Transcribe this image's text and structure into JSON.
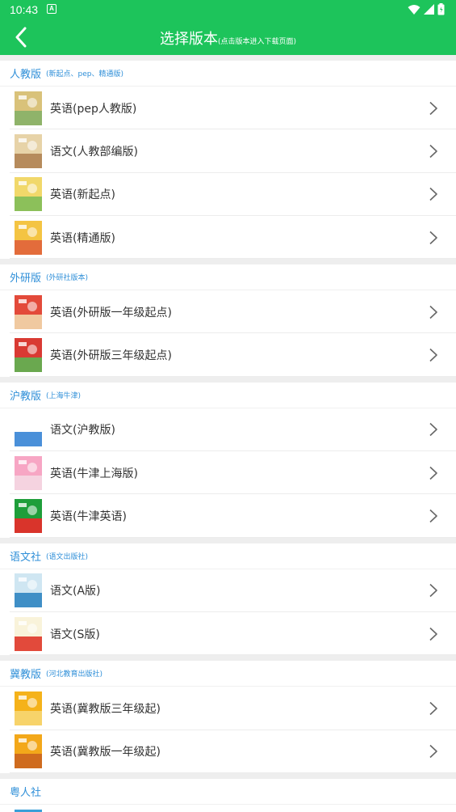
{
  "status": {
    "time": "10:43",
    "badge": "A"
  },
  "header": {
    "title": "选择版本",
    "subtitle": "(点击版本进入下载页面)"
  },
  "colors": {
    "brand": "#1dc45b",
    "section_text": "#2f8fd8"
  },
  "sections": [
    {
      "name": "人教版",
      "sub": "(新起点、pep、精通版)",
      "items": [
        {
          "label": "英语(pep人教版)",
          "icon": "book-cover-icon",
          "c1": "#d9c27a",
          "c2": "#8fb36a"
        },
        {
          "label": "语文(人教部编版)",
          "icon": "book-cover-icon",
          "c1": "#e7d3a8",
          "c2": "#b68b5c"
        },
        {
          "label": "英语(新起点)",
          "icon": "book-cover-icon",
          "c1": "#f1d86a",
          "c2": "#8cc05a"
        },
        {
          "label": "英语(精通版)",
          "icon": "book-cover-icon",
          "c1": "#f4c443",
          "c2": "#e36c3b"
        }
      ]
    },
    {
      "name": "外研版",
      "sub": "(外研社版本)",
      "items": [
        {
          "label": "英语(外研版一年级起点)",
          "icon": "book-cover-icon",
          "c1": "#e34a3a",
          "c2": "#f0c9a0"
        },
        {
          "label": "英语(外研版三年级起点)",
          "icon": "book-cover-icon",
          "c1": "#d93a33",
          "c2": "#6aa84f"
        }
      ]
    },
    {
      "name": "沪教版",
      "sub": "(上海牛津)",
      "items": [
        {
          "label": "语文(沪教版)",
          "icon": "book-cover-icon",
          "c1": "#ffffff",
          "c2": "#4a90d9"
        },
        {
          "label": "英语(牛津上海版)",
          "icon": "book-cover-icon",
          "c1": "#f7a6c4",
          "c2": "#f5d3e0"
        },
        {
          "label": "英语(牛津英语)",
          "icon": "book-cover-icon",
          "c1": "#1e9e3a",
          "c2": "#d9342b"
        }
      ]
    },
    {
      "name": "语文社",
      "sub": "(语文出版社)",
      "items": [
        {
          "label": "语文(A版)",
          "icon": "book-cover-icon",
          "c1": "#cfe6f2",
          "c2": "#3f8fc6"
        },
        {
          "label": "语文(S版)",
          "icon": "book-cover-icon",
          "c1": "#f9f3da",
          "c2": "#e24a3b"
        }
      ]
    },
    {
      "name": "冀教版",
      "sub": "(河北教育出版社)",
      "items": [
        {
          "label": "英语(冀教版三年级起)",
          "icon": "book-cover-icon",
          "c1": "#f5b21a",
          "c2": "#f7d36a"
        },
        {
          "label": "英语(冀教版一年级起)",
          "icon": "book-cover-icon",
          "c1": "#f3a81a",
          "c2": "#cf6b1e"
        }
      ]
    },
    {
      "name": "粤人社",
      "sub": "",
      "items": [
        {
          "label": "",
          "icon": "book-cover-icon",
          "c1": "#3aa0d8",
          "c2": "#1d6fb0"
        }
      ]
    }
  ]
}
